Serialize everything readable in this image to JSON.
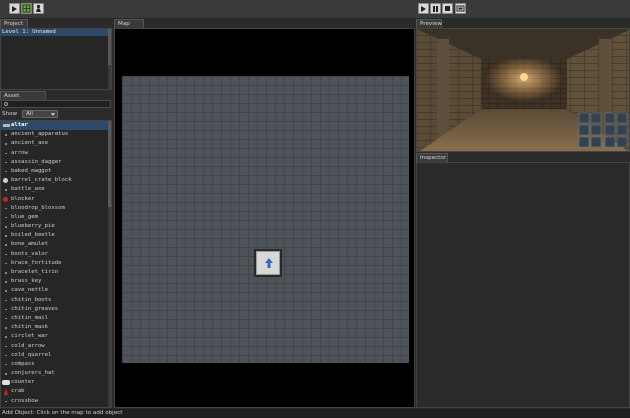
{
  "toolbar": {
    "left_icons": [
      "play-icon",
      "grid-icon",
      "person-icon"
    ],
    "right_icons": [
      "play-icon",
      "pause-icon",
      "stop-icon",
      "fullscreen-icon"
    ]
  },
  "project": {
    "header": "Project",
    "items": [
      "Level 1: Unnamed"
    ]
  },
  "asset_browser": {
    "header": "Asset Browser",
    "search_value": "",
    "show_label": "Show",
    "show_value": "All",
    "items": [
      {
        "name": "altar",
        "icon": "altar-icon",
        "selected": true
      },
      {
        "name": "ancient_apparatus",
        "icon": "dot-icon"
      },
      {
        "name": "ancient_axe",
        "icon": "dot-icon"
      },
      {
        "name": "arrow",
        "icon": "dot-icon"
      },
      {
        "name": "assassin_dagger",
        "icon": "dot-icon"
      },
      {
        "name": "baked_maggot",
        "icon": "dot-icon"
      },
      {
        "name": "barrel_crate_block",
        "icon": "barrel-icon"
      },
      {
        "name": "battle_axe",
        "icon": "dot-icon"
      },
      {
        "name": "blocker",
        "icon": "blocker-icon"
      },
      {
        "name": "bloodrop_blossom",
        "icon": "dot-icon"
      },
      {
        "name": "blue_gem",
        "icon": "dot-icon"
      },
      {
        "name": "blueberry_pie",
        "icon": "dot-icon"
      },
      {
        "name": "boiled_beetle",
        "icon": "dot-icon"
      },
      {
        "name": "bone_amulet",
        "icon": "dot-icon"
      },
      {
        "name": "boots_valor",
        "icon": "dot-icon"
      },
      {
        "name": "brace_fortitude",
        "icon": "dot-icon"
      },
      {
        "name": "bracelet_tirin",
        "icon": "dot-icon"
      },
      {
        "name": "brass_key",
        "icon": "dot-icon"
      },
      {
        "name": "cave_nettle",
        "icon": "dot-icon"
      },
      {
        "name": "chitin_boots",
        "icon": "dot-icon"
      },
      {
        "name": "chitin_greaves",
        "icon": "dot-icon"
      },
      {
        "name": "chitin_mail",
        "icon": "dot-icon"
      },
      {
        "name": "chitin_mask",
        "icon": "dot-icon"
      },
      {
        "name": "circlet_war",
        "icon": "dot-icon"
      },
      {
        "name": "cold_arrow",
        "icon": "dot-icon"
      },
      {
        "name": "cold_quarrel",
        "icon": "dot-icon"
      },
      {
        "name": "compass",
        "icon": "dot-icon"
      },
      {
        "name": "conjurers_hat",
        "icon": "dot-icon"
      },
      {
        "name": "counter",
        "icon": "counter-icon"
      },
      {
        "name": "crab",
        "icon": "crab-icon"
      },
      {
        "name": "crossbow",
        "icon": "dot-icon"
      },
      {
        "name": "crowern",
        "icon": "crow-icon"
      }
    ]
  },
  "map_view": {
    "header": "Map View"
  },
  "preview": {
    "header": "Preview"
  },
  "inspector": {
    "header": "Inspector"
  },
  "status": {
    "text": "Add Object: Click on the map to add object"
  },
  "colors": {
    "selection": "#2e4a6a",
    "grid": "#4e5359",
    "monster": "#cc2020"
  }
}
